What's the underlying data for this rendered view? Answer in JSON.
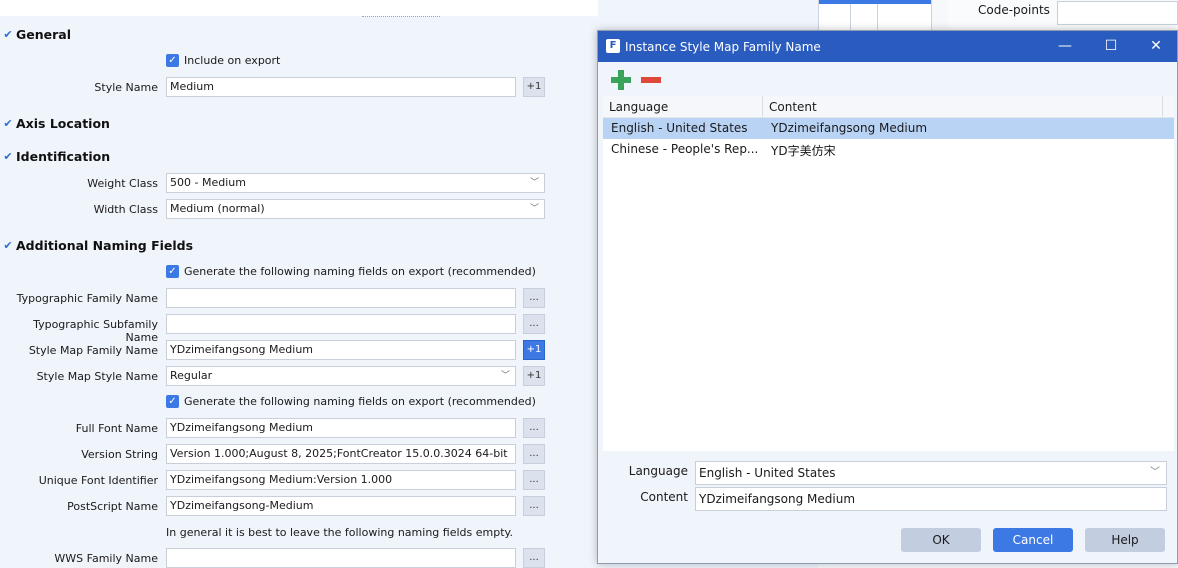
{
  "colors": {
    "accent": "#3d79e4",
    "titlebar": "#2a5bbf",
    "selection": "#b9d3f5",
    "add": "#3aa35a",
    "remove": "#e0463a"
  },
  "background_window": {
    "codepoints_label": "Code-points"
  },
  "panel": {
    "general": {
      "title": "General",
      "include_on_export": "Include on export",
      "style_name_label": "Style Name",
      "style_name_value": "Medium",
      "plus_one": "+1"
    },
    "axis_location": {
      "title": "Axis Location"
    },
    "identification": {
      "title": "Identification",
      "weight_label": "Weight Class",
      "weight_value": "500 - Medium",
      "width_label": "Width Class",
      "width_value": "Medium (normal)"
    },
    "naming": {
      "title": "Additional Naming Fields",
      "generate_1": "Generate the following naming fields on export (recommended)",
      "typo_family_label": "Typographic Family Name",
      "typo_family_value": "",
      "typo_subfamily_label": "Typographic Subfamily Name",
      "typo_subfamily_value": "",
      "style_map_family_label": "Style Map Family Name",
      "style_map_family_value": "YDzimeifangsong Medium",
      "style_map_style_label": "Style Map Style Name",
      "style_map_style_value": "Regular",
      "generate_2": "Generate the following naming fields on export (recommended)",
      "full_font_label": "Full Font Name",
      "full_font_value": "YDzimeifangsong Medium",
      "version_label": "Version String",
      "version_value": "Version 1.000;August 8, 2025;FontCreator 15.0.0.3024 64-bit",
      "unique_id_label": "Unique Font Identifier",
      "unique_id_value": "YDzimeifangsong Medium:Version 1.000",
      "postscript_label": "PostScript Name",
      "postscript_value": "YDzimeifangsong-Medium",
      "hint": "In general it is best to leave the following naming fields empty.",
      "wws_family_label": "WWS Family Name",
      "wws_family_value": "",
      "ellipsis": "...",
      "plus_one": "+1"
    }
  },
  "dialog": {
    "title": "Instance Style Map Family Name",
    "columns": [
      "Language",
      "Content"
    ],
    "rows": [
      {
        "language": "English - United States",
        "content": "YDzimeifangsong Medium",
        "selected": true
      },
      {
        "language": "Chinese - People's Rep...",
        "content": "YD字美仿宋",
        "selected": false
      }
    ],
    "language_label": "Language",
    "language_value": "English - United States",
    "content_label": "Content",
    "content_value": "YDzimeifangsong Medium",
    "buttons": {
      "ok": "OK",
      "cancel": "Cancel",
      "help": "Help"
    }
  }
}
